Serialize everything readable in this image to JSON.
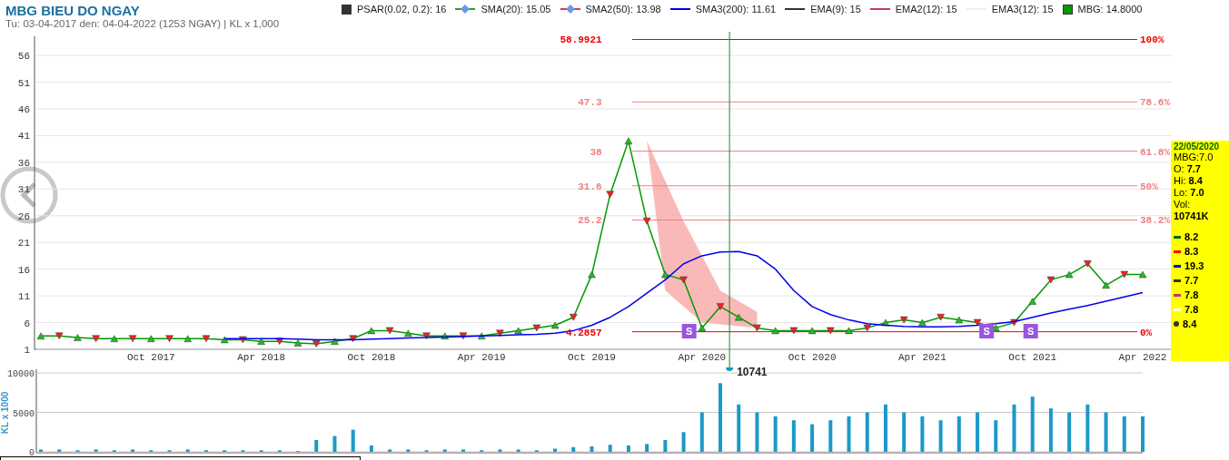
{
  "header": {
    "title": "MBG BIEU DO NGAY",
    "subtitle": "Tu: 03-04-2017 den: 04-04-2022 (1253 NGAY) | KL x 1,000"
  },
  "legend": [
    {
      "kind": "square",
      "color": "#333333",
      "label": "PSAR(0.02, 0.2): 16"
    },
    {
      "kind": "diamond",
      "color": "#339933",
      "label": "SMA(20): 15.05"
    },
    {
      "kind": "diamond",
      "color": "#ee3333",
      "label": "SMA2(50): 13.98"
    },
    {
      "kind": "line",
      "color": "#0000ee",
      "label": "SMA3(200): 11.61"
    },
    {
      "kind": "line",
      "color": "#333333",
      "label": "EMA(9): 15"
    },
    {
      "kind": "line",
      "color": "#cc3366",
      "label": "EMA2(12): 15"
    },
    {
      "kind": "line",
      "color": "#eeeeee",
      "label": "EMA3(12): 15"
    },
    {
      "kind": "square",
      "color": "#009900",
      "label": "MBG: 14.8000"
    }
  ],
  "price_chart": {
    "chart_data": {
      "type": "line",
      "ylim": [
        1,
        59.6
      ],
      "grid": true,
      "categories": [
        null,
        null,
        null,
        null,
        null,
        null,
        "Oct 2017",
        null,
        null,
        null,
        null,
        null,
        "Apr 2018",
        null,
        null,
        null,
        null,
        null,
        "Oct 2018",
        null,
        null,
        null,
        null,
        null,
        "Apr 2019",
        null,
        null,
        null,
        null,
        null,
        "Oct 2019",
        null,
        null,
        null,
        null,
        null,
        "Apr 2020",
        null,
        null,
        null,
        null,
        null,
        "Oct 2020",
        null,
        null,
        null,
        null,
        null,
        "Apr 2021",
        null,
        null,
        null,
        null,
        null,
        "Oct 2021",
        null,
        null,
        null,
        null,
        null,
        "Apr 2022"
      ],
      "series": [
        {
          "color": "#009900",
          "marker": "triangle",
          "values": [
            3.5,
            3.5,
            3.2,
            3,
            3,
            3,
            3,
            3,
            3,
            3,
            2.8,
            2.8,
            2.5,
            2.5,
            2.2,
            2,
            2.5,
            3,
            4.5,
            4.5,
            4,
            3.5,
            3.5,
            3.5,
            3.5,
            4,
            4.5,
            5,
            5.5,
            7,
            15,
            30,
            40,
            25,
            15,
            14,
            5,
            9,
            7,
            5,
            4.5,
            4.5,
            4.5,
            4.5,
            4.5,
            5,
            6,
            6.5,
            6,
            7,
            6.5,
            6,
            5,
            6,
            10,
            14,
            15,
            17,
            13,
            15,
            15
          ]
        },
        {
          "color": "#0000ee",
          "values": [
            null,
            null,
            null,
            null,
            null,
            null,
            null,
            null,
            null,
            null,
            3,
            3,
            3,
            3,
            2.9,
            2.8,
            2.8,
            2.8,
            2.9,
            3,
            3.1,
            3.2,
            3.3,
            3.4,
            3.5,
            3.6,
            3.7,
            3.8,
            4,
            4.5,
            5.5,
            7,
            9,
            11.5,
            14,
            17,
            18.5,
            19.2,
            19.3,
            18.5,
            16,
            12,
            9,
            7.5,
            6.5,
            5.8,
            5.5,
            5.3,
            5.2,
            5.2,
            5.3,
            5.5,
            5.8,
            6.2,
            7,
            7.8,
            8.5,
            9.2,
            10,
            10.8,
            11.6
          ]
        }
      ],
      "yticks": [
        1,
        6,
        11,
        16,
        21,
        26,
        31,
        36,
        41,
        46,
        51,
        56
      ]
    },
    "fibonacci_levels": [
      {
        "value": "58.9921",
        "percent": "100%"
      },
      {
        "value": "47.3",
        "percent": "78.6%"
      },
      {
        "value": "38",
        "percent": "61.8%"
      },
      {
        "value": "31.6",
        "percent": "50%"
      },
      {
        "value": "25.2",
        "percent": "38.2%"
      },
      {
        "value": "4.2857",
        "percent": "0%"
      }
    ],
    "signals": [
      {
        "text": "S"
      },
      {
        "text": "S"
      },
      {
        "text": "S"
      }
    ]
  },
  "tooltip": {
    "date": "22/05/2020",
    "symbol": "MBG:7.0",
    "fields": [
      {
        "label": "O:",
        "value": "7.7"
      },
      {
        "label": "Hi:",
        "value": "8.4"
      },
      {
        "label": "Lo:",
        "value": "7.0"
      },
      {
        "label": "Vol:",
        "value": "10741K"
      }
    ],
    "readings": [
      {
        "kind": "dash",
        "color": "#006600",
        "value": "8.2"
      },
      {
        "kind": "dash",
        "color": "#ff0000",
        "value": "8.3"
      },
      {
        "kind": "dash",
        "color": "#0000ee",
        "value": "19.3"
      },
      {
        "kind": "dash",
        "color": "#333333",
        "value": "7.7"
      },
      {
        "kind": "dash",
        "color": "#cc3366",
        "value": "7.8"
      },
      {
        "kind": "dash",
        "color": "#ffffff",
        "value": "7.8"
      },
      {
        "kind": "dot",
        "color": "#333333",
        "value": "8.4"
      }
    ]
  },
  "volume_chart": {
    "chart_data": {
      "type": "bar",
      "ylabel": "KL x 1000",
      "ylim": [
        0,
        10000
      ],
      "yticks": [
        0,
        5000,
        10000
      ],
      "values": [
        300,
        300,
        200,
        300,
        200,
        300,
        200,
        200,
        300,
        200,
        200,
        200,
        200,
        200,
        100,
        1500,
        2000,
        2800,
        800,
        300,
        300,
        200,
        300,
        300,
        200,
        300,
        300,
        200,
        400,
        600,
        700,
        900,
        800,
        1000,
        1500,
        2500,
        5000,
        8700,
        6000,
        5000,
        4500,
        4000,
        3500,
        4000,
        4500,
        5000,
        6000,
        5000,
        4500,
        4000,
        4500,
        5000,
        4000,
        6000,
        7000,
        5500,
        5000,
        6000,
        5000,
        4500,
        4500
      ]
    },
    "cursor_value": "10741"
  }
}
